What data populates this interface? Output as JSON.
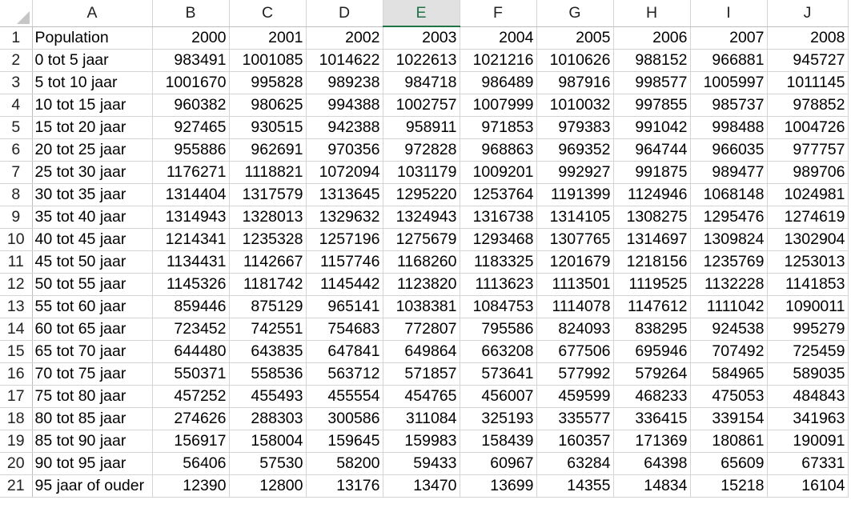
{
  "columns": [
    "A",
    "B",
    "C",
    "D",
    "E",
    "F",
    "G",
    "H",
    "I",
    "J"
  ],
  "selected_column": "E",
  "corner_icon": "select-all-triangle-icon",
  "header_row": {
    "label": "Population",
    "years": [
      "2000",
      "2001",
      "2002",
      "2003",
      "2004",
      "2005",
      "2006",
      "2007",
      "2008"
    ]
  },
  "rows": [
    {
      "label": "0 tot 5 jaar",
      "values": [
        "983491",
        "1001085",
        "1014622",
        "1022613",
        "1021216",
        "1010626",
        "988152",
        "966881",
        "945727"
      ]
    },
    {
      "label": "5 tot 10 jaar",
      "values": [
        "1001670",
        "995828",
        "989238",
        "984718",
        "986489",
        "987916",
        "998577",
        "1005997",
        "1011145"
      ]
    },
    {
      "label": "10 tot 15 jaar",
      "values": [
        "960382",
        "980625",
        "994388",
        "1002757",
        "1007999",
        "1010032",
        "997855",
        "985737",
        "978852"
      ]
    },
    {
      "label": "15 tot 20 jaar",
      "values": [
        "927465",
        "930515",
        "942388",
        "958911",
        "971853",
        "979383",
        "991042",
        "998488",
        "1004726"
      ]
    },
    {
      "label": "20 tot 25 jaar",
      "values": [
        "955886",
        "962691",
        "970356",
        "972828",
        "968863",
        "969352",
        "964744",
        "966035",
        "977757"
      ]
    },
    {
      "label": "25 tot 30 jaar",
      "values": [
        "1176271",
        "1118821",
        "1072094",
        "1031179",
        "1009201",
        "992927",
        "991875",
        "989477",
        "989706"
      ]
    },
    {
      "label": "30 tot 35 jaar",
      "values": [
        "1314404",
        "1317579",
        "1313645",
        "1295220",
        "1253764",
        "1191399",
        "1124946",
        "1068148",
        "1024981"
      ]
    },
    {
      "label": "35 tot 40 jaar",
      "values": [
        "1314943",
        "1328013",
        "1329632",
        "1324943",
        "1316738",
        "1314105",
        "1308275",
        "1295476",
        "1274619"
      ]
    },
    {
      "label": "40 tot 45 jaar",
      "values": [
        "1214341",
        "1235328",
        "1257196",
        "1275679",
        "1293468",
        "1307765",
        "1314697",
        "1309824",
        "1302904"
      ]
    },
    {
      "label": "45 tot 50 jaar",
      "values": [
        "1134431",
        "1142667",
        "1157746",
        "1168260",
        "1183325",
        "1201679",
        "1218156",
        "1235769",
        "1253013"
      ]
    },
    {
      "label": "50 tot 55 jaar",
      "values": [
        "1145326",
        "1181742",
        "1145442",
        "1123820",
        "1113623",
        "1113501",
        "1119525",
        "1132228",
        "1141853"
      ]
    },
    {
      "label": "55 tot 60 jaar",
      "values": [
        "859446",
        "875129",
        "965141",
        "1038381",
        "1084753",
        "1114078",
        "1147612",
        "1111042",
        "1090011"
      ]
    },
    {
      "label": "60 tot 65 jaar",
      "values": [
        "723452",
        "742551",
        "754683",
        "772807",
        "795586",
        "824093",
        "838295",
        "924538",
        "995279"
      ]
    },
    {
      "label": "65 tot 70 jaar",
      "values": [
        "644480",
        "643835",
        "647841",
        "649864",
        "663208",
        "677506",
        "695946",
        "707492",
        "725459"
      ]
    },
    {
      "label": "70 tot 75 jaar",
      "values": [
        "550371",
        "558536",
        "563712",
        "571857",
        "573641",
        "577992",
        "579264",
        "584965",
        "589035"
      ]
    },
    {
      "label": "75 tot 80 jaar",
      "values": [
        "457252",
        "455493",
        "455554",
        "454765",
        "456007",
        "459599",
        "468233",
        "475053",
        "484843"
      ]
    },
    {
      "label": "80 tot 85 jaar",
      "values": [
        "274626",
        "288303",
        "300586",
        "311084",
        "325193",
        "335577",
        "336415",
        "339154",
        "341963"
      ]
    },
    {
      "label": "85 tot 90 jaar",
      "values": [
        "156917",
        "158004",
        "159645",
        "159983",
        "158439",
        "160357",
        "171369",
        "180861",
        "190091"
      ]
    },
    {
      "label": "90 tot 95 jaar",
      "values": [
        "56406",
        "57530",
        "58200",
        "59433",
        "60967",
        "63284",
        "64398",
        "65609",
        "67331"
      ]
    },
    {
      "label": "95 jaar of ouder",
      "values": [
        "12390",
        "12800",
        "13176",
        "13470",
        "13699",
        "14355",
        "14834",
        "15218",
        "16104"
      ]
    }
  ]
}
